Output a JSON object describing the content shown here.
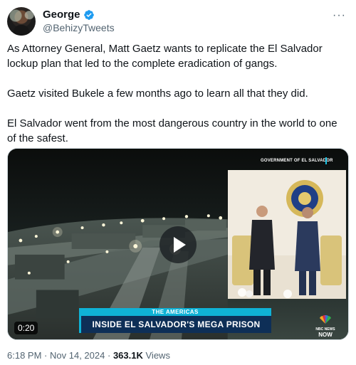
{
  "author": {
    "display_name": "George",
    "handle": "@BehizyTweets",
    "verified": true,
    "avatar_icon": "avatar-photo"
  },
  "more_label": "···",
  "tweet": {
    "paragraphs": [
      "As Attorney General, Matt Gaetz wants to replicate the El Salvador lockup plan that led to the complete eradication of gangs.",
      "Gaetz visited Bukele a few months ago to learn all that they did.",
      "El Salvador went from the most dangerous country in the world to one of the safest."
    ]
  },
  "media": {
    "overlay_source": "GOVERNMENT OF EL SALVADOR",
    "section": "THE AMERICAS",
    "headline": "INSIDE EL SALVADOR'S MEGA PRISON",
    "duration": "0:20",
    "network_top": "NBC NEWS",
    "network_bottom": "NOW",
    "accent_color": "#0fb2d6",
    "banner_color": "#0e2f57"
  },
  "footer": {
    "time": "6:18 PM",
    "separator": "·",
    "date": "Nov 14, 2024",
    "views_count": "363.1K",
    "views_label": "Views"
  },
  "colors": {
    "verified_blue": "#1d9bf0",
    "secondary_text": "#536471"
  }
}
